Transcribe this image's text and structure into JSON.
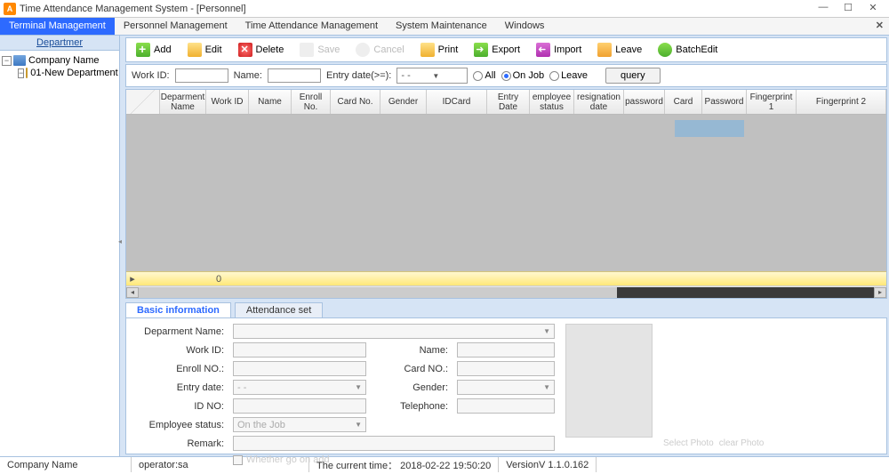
{
  "window": {
    "title": "Time Attendance Management System - [Personnel]",
    "app_icon_letter": "A"
  },
  "menu": {
    "tabs": [
      "Terminal Management",
      "Personnel Management",
      "Time Attendance Management",
      "System Maintenance",
      "Windows"
    ],
    "active": 0
  },
  "sidebar": {
    "header": "Departmer",
    "root": "Company Name",
    "child": "01-New Department"
  },
  "toolbar": {
    "add": "Add",
    "edit": "Edit",
    "del": "Delete",
    "save": "Save",
    "cancel": "Cancel",
    "print": "Print",
    "export": "Export",
    "import": "Import",
    "leave": "Leave",
    "batch": "BatchEdit"
  },
  "filter": {
    "workid_lbl": "Work ID:",
    "name_lbl": "Name:",
    "entry_lbl": "Entry date(>=):",
    "date_placeholder": "- -",
    "opt_all": "All",
    "opt_onjob": "On Job",
    "opt_leave": "Leave",
    "query": "query"
  },
  "grid": {
    "cols": [
      "Deparment Name",
      "Work ID",
      "Name",
      "Enroll No.",
      "Card No.",
      "Gender",
      "IDCard",
      "Entry Date",
      "employee status",
      "resignation date",
      "password",
      "Card",
      "Password",
      "Fingerprint 1",
      "Fingerprint 2"
    ],
    "count": "0"
  },
  "detail": {
    "tab1": "Basic information",
    "tab2": "Attendance set",
    "labels": {
      "dep": "Deparment Name:",
      "work": "Work ID:",
      "name": "Name:",
      "enroll": "Enroll NO.:",
      "card": "Card NO.:",
      "entry": "Entry date:",
      "gender": "Gender:",
      "idno": "ID NO:",
      "tel": "Telephone:",
      "emp": "Employee status:",
      "remark": "Remark:",
      "emp_val": "On the Job",
      "date_placeholder": "- -",
      "auto": "Whether go on add"
    },
    "photo": {
      "select": "Select Photo",
      "clear": "clear Photo"
    }
  },
  "status": {
    "company": "Company Name",
    "operator": "operator:sa",
    "time": "The current time： 2018-02-22 19:50:20",
    "version": "VersionV 1.1.0.162"
  }
}
